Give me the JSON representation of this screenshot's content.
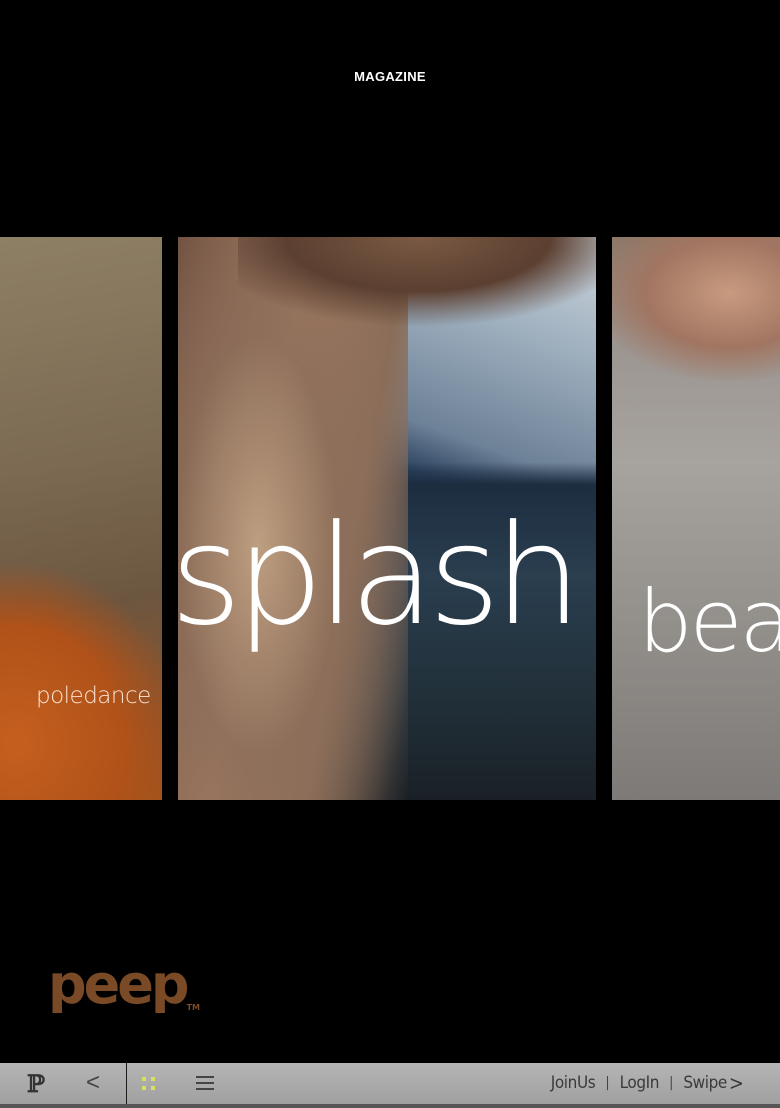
{
  "header": {
    "title": "MAGAZINE"
  },
  "carousel": {
    "cards": [
      {
        "label": "poledance"
      },
      {
        "label": "splash"
      },
      {
        "label": "bea"
      }
    ]
  },
  "brand": {
    "logo_text": "peep",
    "trademark": "TM",
    "color": "#7a4a26"
  },
  "toolbar": {
    "logo_glyph": "ℙ",
    "prev_glyph": "<",
    "links": {
      "join": "JoinUs",
      "login": "LogIn",
      "swipe": "Swipe",
      "separator": "|",
      "swipe_arrow": ">"
    },
    "accent": "#d8e060"
  }
}
